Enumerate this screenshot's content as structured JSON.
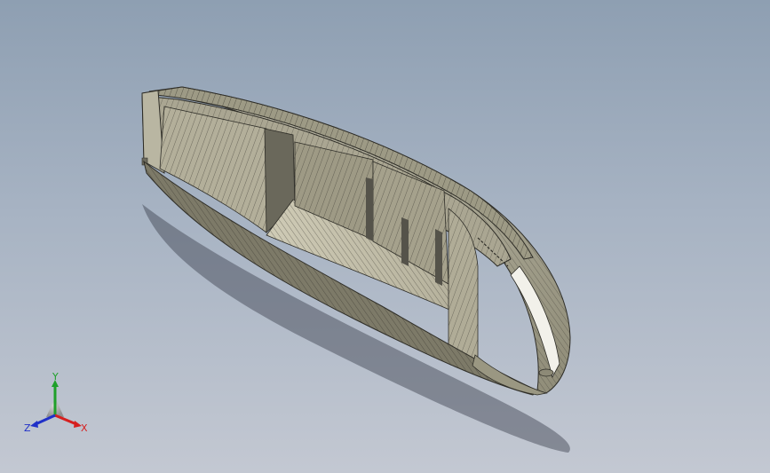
{
  "triad": {
    "x_label": "X",
    "y_label": "Y",
    "z_label": "Z",
    "x_color": "#d61f1f",
    "y_color": "#1fa02a",
    "z_color": "#2030c8"
  },
  "model": {
    "icon": "boat-hull-3d-model",
    "shade_color": "#a9a592",
    "dark_color": "#5d5b50"
  }
}
